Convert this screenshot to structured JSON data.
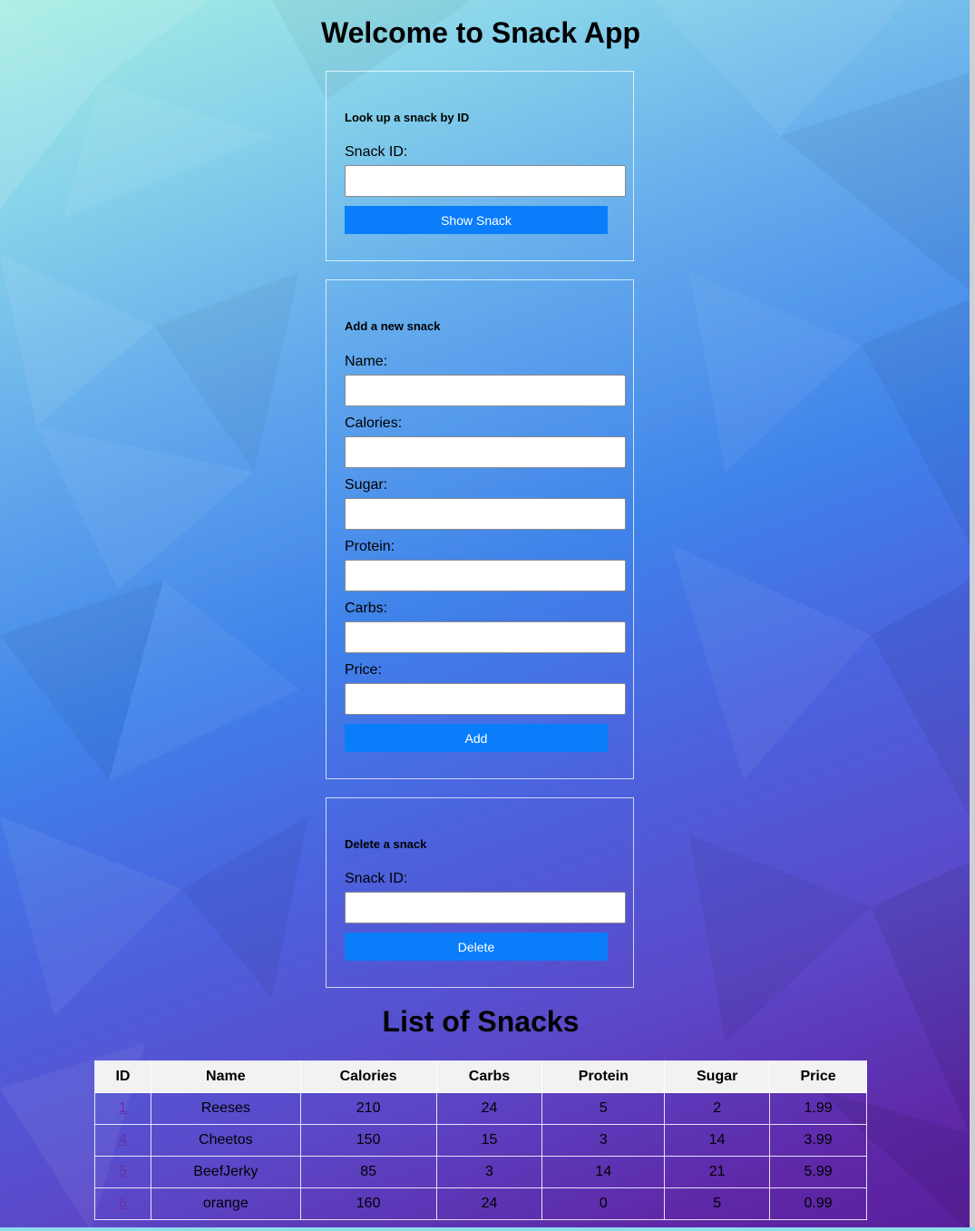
{
  "header": {
    "title": "Welcome to Snack App"
  },
  "lookup": {
    "heading": "Look up a snack by ID",
    "id_label": "Snack ID:",
    "id_value": "",
    "button_label": "Show Snack"
  },
  "add": {
    "heading": "Add a new snack",
    "fields": [
      {
        "label": "Name:",
        "value": ""
      },
      {
        "label": "Calories:",
        "value": ""
      },
      {
        "label": "Sugar:",
        "value": ""
      },
      {
        "label": "Protein:",
        "value": ""
      },
      {
        "label": "Carbs:",
        "value": ""
      },
      {
        "label": "Price:",
        "value": ""
      }
    ],
    "button_label": "Add"
  },
  "delete": {
    "heading": "Delete a snack",
    "id_label": "Snack ID:",
    "id_value": "",
    "button_label": "Delete"
  },
  "list": {
    "title": "List of Snacks",
    "columns": [
      "ID",
      "Name",
      "Calories",
      "Carbs",
      "Protein",
      "Sugar",
      "Price"
    ],
    "rows": [
      [
        "1",
        "Reeses",
        "210",
        "24",
        "5",
        "2",
        "1.99"
      ],
      [
        "4",
        "Cheetos",
        "150",
        "15",
        "3",
        "14",
        "3.99"
      ],
      [
        "5",
        "BeefJerky",
        "85",
        "3",
        "14",
        "21",
        "5.99"
      ],
      [
        "6",
        "orange",
        "160",
        "24",
        "0",
        "5",
        "0.99"
      ]
    ]
  },
  "colors": {
    "button": "#0a7dfb",
    "link": "#6a2ea0",
    "header_cell": "#f2f2f2"
  }
}
